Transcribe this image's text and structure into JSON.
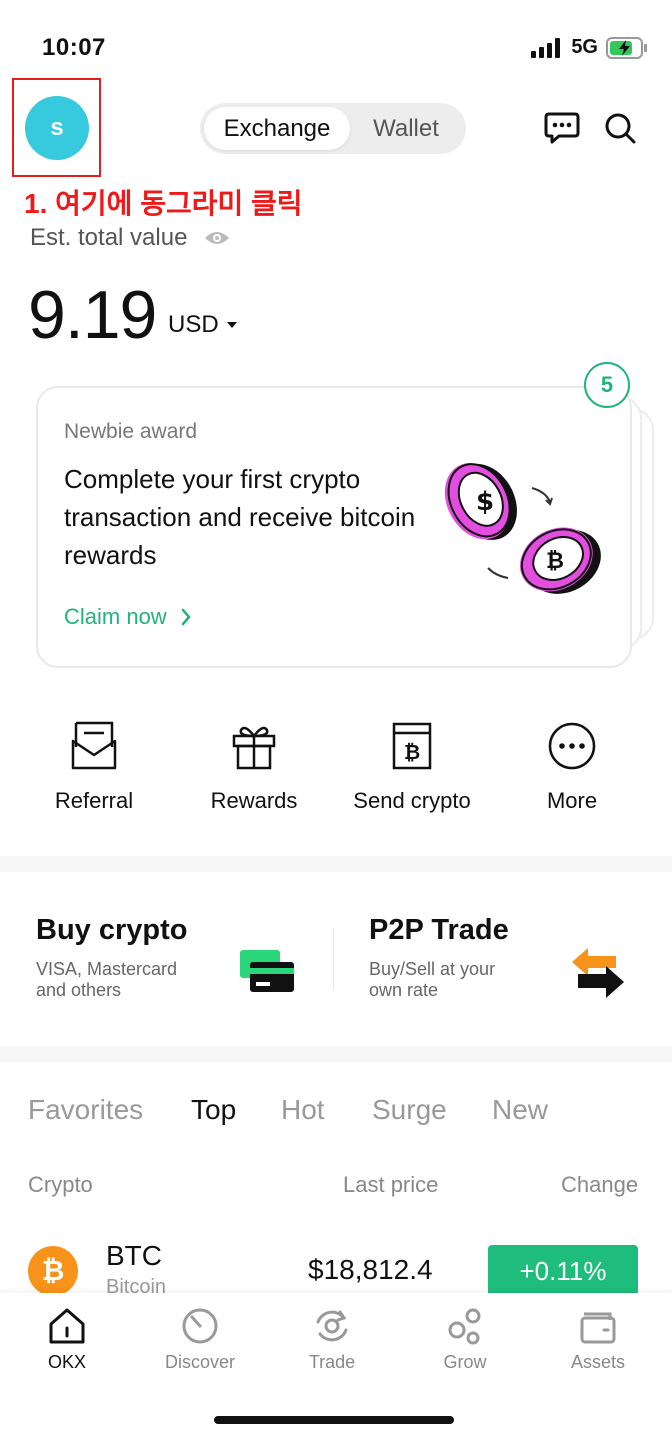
{
  "status": {
    "time": "10:07",
    "network": "5G"
  },
  "header": {
    "avatar_letter": "s",
    "annotation": "1. 여기에 동그라미 클릭",
    "segments": [
      "Exchange",
      "Wallet"
    ],
    "icons": [
      "chat-icon",
      "search-icon"
    ]
  },
  "balance": {
    "label": "Est. total value",
    "amount": "9.19",
    "currency": "USD"
  },
  "promo": {
    "badge": "5",
    "kicker": "Newbie award",
    "text": "Complete your first crypto transaction and receive bitcoin rewards",
    "cta": "Claim now"
  },
  "quick_actions": [
    {
      "label": "Referral",
      "icon": "envelope-icon"
    },
    {
      "label": "Rewards",
      "icon": "gift-icon"
    },
    {
      "label": "Send crypto",
      "icon": "send-crypto-icon"
    },
    {
      "label": "More",
      "icon": "more-icon"
    }
  ],
  "buy": {
    "title": "Buy crypto",
    "sub1": "VISA, Mastercard",
    "sub2": "and others"
  },
  "p2p": {
    "title": "P2P Trade",
    "sub1": "Buy/Sell at your",
    "sub2": "own rate"
  },
  "market": {
    "tabs": [
      "Favorites",
      "Top",
      "Hot",
      "Surge",
      "New"
    ],
    "active_tab": "Top",
    "columns": [
      "Crypto",
      "Last price",
      "Change"
    ],
    "rows": [
      {
        "symbol": "BTC",
        "name": "Bitcoin",
        "price": "$18,812.4",
        "change": "+0.11%"
      }
    ]
  },
  "nav": [
    {
      "label": "OKX",
      "icon": "home-icon",
      "active": true
    },
    {
      "label": "Discover",
      "icon": "discover-icon"
    },
    {
      "label": "Trade",
      "icon": "trade-icon"
    },
    {
      "label": "Grow",
      "icon": "grow-icon"
    },
    {
      "label": "Assets",
      "icon": "wallet-icon"
    }
  ],
  "colors": {
    "accent": "#20b37a",
    "positive": "#1ebd7c",
    "avatar": "#37c9dd",
    "annotation": "#ee1a1a"
  }
}
